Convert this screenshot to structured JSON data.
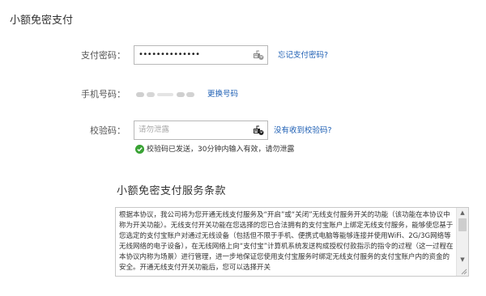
{
  "page": {
    "title": "小额免密支付"
  },
  "form": {
    "password": {
      "label": "支付密码：",
      "value": "••••••••••••••",
      "forgot_link": "忘记支付密码?"
    },
    "phone": {
      "label": "手机号码：",
      "change_link": "更换号码"
    },
    "code": {
      "label": "校验码：",
      "placeholder": "请勿泄露",
      "not_received_link": "没有收到校验码?",
      "sent_hint": "校验码已发送，30分钟内输入有效，请勿泄露"
    }
  },
  "terms": {
    "title": "小额免密支付服务条款",
    "text": "根据本协议，我公司将为您开通无线支付服务及“开启”或“关闭”无线支付服务开关的功能（该功能在本协议中称为开关功能）。无线支付开关功能在您选择的您已合法拥有的支付宝账户上绑定无线支付服务，能够使您基于您选定的支付宝账户对通过无线设备（包括但不限于手机、便携式电脑等能够连接并使用WiFi、2G/3G网络等无线网络的电子设备），在无线网络上向“支付宝”计算机系统发送构成授权付款指示的指令的过程（这一过程在本协议内称为场景）进行管理，进一步地保证您使用支付宝服务时绑定无线支付服务的支付宝账户内的资金的安全。开通无线支付开关功能后，您可以选择开关"
  },
  "colors": {
    "link": "#1e5fb4",
    "success": "#3aa335"
  },
  "icons": {
    "keyboard": "keyboard-icon",
    "success": "check-circle-icon"
  }
}
